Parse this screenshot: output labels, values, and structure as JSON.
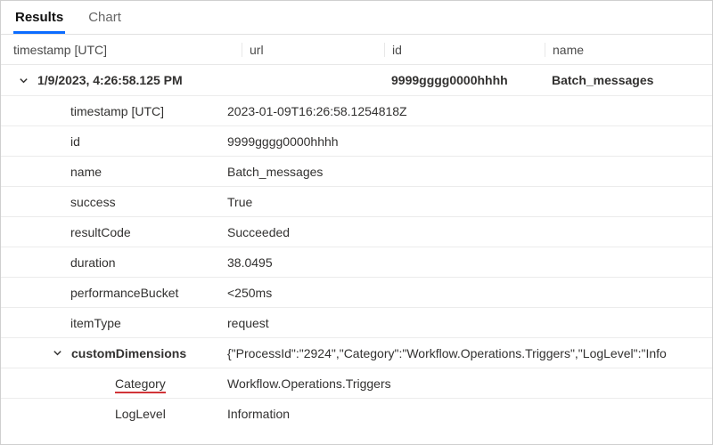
{
  "tabs": {
    "results": "Results",
    "chart": "Chart",
    "active": "results"
  },
  "columns": {
    "timestamp": "timestamp [UTC]",
    "url": "url",
    "id": "id",
    "name": "name"
  },
  "summary": {
    "timestamp": "1/9/2023, 4:26:58.125 PM",
    "url": "",
    "id": "9999gggg0000hhhh",
    "name": "Batch_messages"
  },
  "details": {
    "timestamp_label": "timestamp [UTC]",
    "timestamp_value": "2023-01-09T16:26:58.1254818Z",
    "id_label": "id",
    "id_value": "9999gggg0000hhhh",
    "name_label": "name",
    "name_value": "Batch_messages",
    "success_label": "success",
    "success_value": "True",
    "resultCode_label": "resultCode",
    "resultCode_value": "Succeeded",
    "duration_label": "duration",
    "duration_value": "38.0495",
    "performanceBucket_label": "performanceBucket",
    "performanceBucket_value": "<250ms",
    "itemType_label": "itemType",
    "itemType_value": "request"
  },
  "customDimensions": {
    "label": "customDimensions",
    "json": "{\"ProcessId\":\"2924\",\"Category\":\"Workflow.Operations.Triggers\",\"LogLevel\":\"Info",
    "category_label": "Category",
    "category_value": "Workflow.Operations.Triggers",
    "loglevel_label": "LogLevel",
    "loglevel_value": "Information"
  }
}
